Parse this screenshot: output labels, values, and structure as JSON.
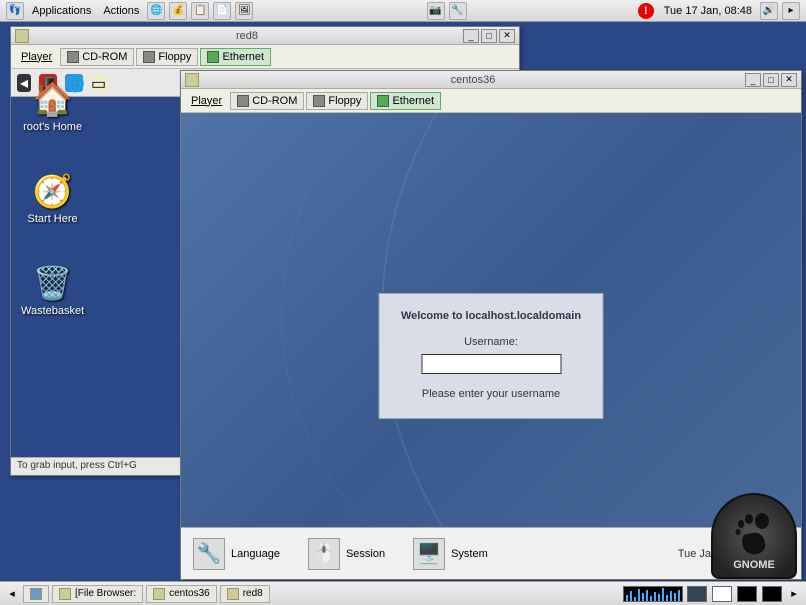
{
  "top_panel": {
    "menu": [
      "Applications",
      "Actions"
    ],
    "clock": "Tue 17 Jan, 08:48",
    "alert": "!"
  },
  "red8": {
    "title": "red8",
    "tabs": {
      "player": "Player",
      "cdrom": "CD-ROM",
      "floppy": "Floppy",
      "ethernet": "Ethernet"
    },
    "desktop": {
      "home": "root's Home",
      "start": "Start Here",
      "trash": "Wastebasket"
    },
    "status": "To grab input, press Ctrl+G"
  },
  "centos": {
    "title": "centos36",
    "tabs": {
      "player": "Player",
      "cdrom": "CD-ROM",
      "floppy": "Floppy",
      "ethernet": "Ethernet"
    },
    "login": {
      "welcome": "Welcome to localhost.localdomain",
      "username_label": "Username:",
      "username_value": "",
      "hint": "Please enter your username"
    },
    "bottom": {
      "language": "Language",
      "session": "Session",
      "system": "System",
      "time": "Tue Jan 17, 08:48 AM"
    },
    "gnome": "GNOME"
  },
  "bottom_panel": {
    "file_browser": "[File Browser:",
    "centos_task": "centos36",
    "red8_task": "red8"
  }
}
